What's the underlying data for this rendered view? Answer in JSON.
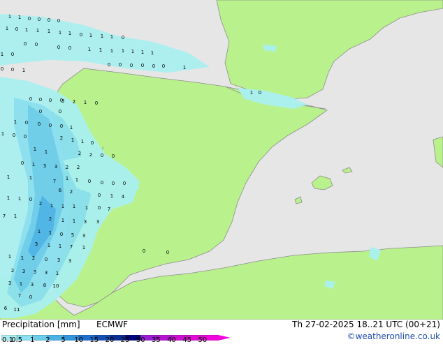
{
  "legend": {
    "title": "Precipitation [mm]",
    "model": "ECMWF",
    "ticks": [
      "0.1",
      "0.5",
      "1",
      "2",
      "5",
      "10",
      "15",
      "20",
      "25",
      "30",
      "35",
      "40",
      "45",
      "50"
    ],
    "colors": [
      "#aaf0f0",
      "#8ae0f0",
      "#6acdea",
      "#4ab4e6",
      "#3296dc",
      "#1e6ed0",
      "#1450b4",
      "#0a2f96",
      "#000078",
      "#9b1cd4",
      "#b414d2",
      "#cd0fd2",
      "#e10ad7",
      "#f005dc"
    ]
  },
  "forecast_time": "Th 27-02-2025 18..21 UTC (00+21)",
  "credit": "©weatheronline.co.uk",
  "map_colors": {
    "sea": "#e6e6e6",
    "land": "#b9f28c",
    "border": "#8c8c8c"
  },
  "precip_values": [
    "1",
    "1",
    "0",
    "0",
    "0",
    "0",
    "1",
    "0",
    "1",
    "1",
    "1",
    "1",
    "1",
    "0",
    "1",
    "1",
    "1",
    "0",
    "0",
    "0",
    "0",
    "0",
    "1",
    "1",
    "1",
    "1",
    "1",
    "1",
    "1",
    "1",
    "0",
    "0",
    "0",
    "0",
    "0",
    "0",
    "0",
    "0",
    "0",
    "1",
    "1",
    "1",
    "0",
    "0",
    "0",
    "0",
    "0",
    "3",
    "2",
    "1",
    "0",
    "0",
    "0",
    "1",
    "0",
    "0",
    "0",
    "0",
    "1",
    "1",
    "0",
    "0",
    "2",
    "1",
    "1",
    "0",
    "1",
    "1",
    "2",
    "2",
    "0",
    "0",
    "0",
    "1",
    "3",
    "3",
    "2",
    "2",
    "1",
    "1",
    "1",
    "1",
    "0",
    "0",
    "0",
    "0",
    "7",
    "6",
    "2",
    "1",
    "1",
    "0",
    "0",
    "1",
    "4",
    "2",
    "1",
    "1",
    "1",
    "1",
    "0",
    "7",
    "7",
    "1",
    "2",
    "1",
    "1",
    "3",
    "3",
    "1",
    "1",
    "0",
    "5",
    "3",
    "3",
    "1",
    "1",
    "7",
    "1",
    "1",
    "1",
    "2",
    "0",
    "3",
    "3",
    "2",
    "3",
    "3",
    "3",
    "1",
    "3",
    "1",
    "3",
    "8",
    "10",
    "7",
    "0",
    "6",
    "11",
    "5",
    "2"
  ],
  "places": [
    "0",
    "0"
  ]
}
